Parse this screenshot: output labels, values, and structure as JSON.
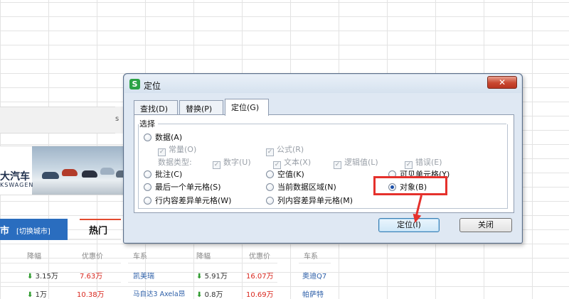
{
  "dialog": {
    "title": "定位",
    "close_label": "✕",
    "tabs": [
      {
        "label": "查找(D)"
      },
      {
        "label": "替换(P)"
      },
      {
        "label": "定位(G)"
      }
    ],
    "group_label": "选择",
    "options": {
      "data": "数据(A)",
      "constant": "常量(O)",
      "formula": "公式(R)",
      "data_type_label": "数据类型:",
      "number": "数字(U)",
      "text": "文本(X)",
      "logical": "逻辑值(L)",
      "error": "错误(E)",
      "comment": "批注(C)",
      "blank": "空值(K)",
      "visible_cells": "可见单元格(Y)",
      "last_cell": "最后一个单元格(S)",
      "current_region": "当前数据区域(N)",
      "object": "对象(B)",
      "row_diff": "行内容差异单元格(W)",
      "col_diff": "列内容差异单元格(M)"
    },
    "buttons": {
      "locate": "定位(I)",
      "close": "关闭"
    }
  },
  "background": {
    "brand_title": "大汽车",
    "brand_sub": "KSWAGEN",
    "city_label": "市",
    "city_switch": "[切换城市]",
    "hot_label": "热门",
    "side_char": "s",
    "left_table": {
      "headers": [
        "降幅",
        "优惠价"
      ],
      "rows": [
        {
          "drop": "3.15万",
          "price": "7.63万"
        },
        {
          "drop": "1万",
          "price": "10.38万"
        }
      ]
    },
    "mid_table": {
      "headers": [
        "车系",
        "降幅",
        "优惠价"
      ],
      "rows": [
        {
          "series": "凯美瑞",
          "drop": "5.91万",
          "price": "16.07万"
        },
        {
          "series": "马自达3 Axela昂",
          "drop": "0.8万",
          "price": "10.69万"
        }
      ]
    },
    "right_table": {
      "headers": [
        "车系"
      ],
      "rows": [
        {
          "series": "奥迪Q7"
        },
        {
          "series": "帕萨特"
        }
      ]
    }
  }
}
